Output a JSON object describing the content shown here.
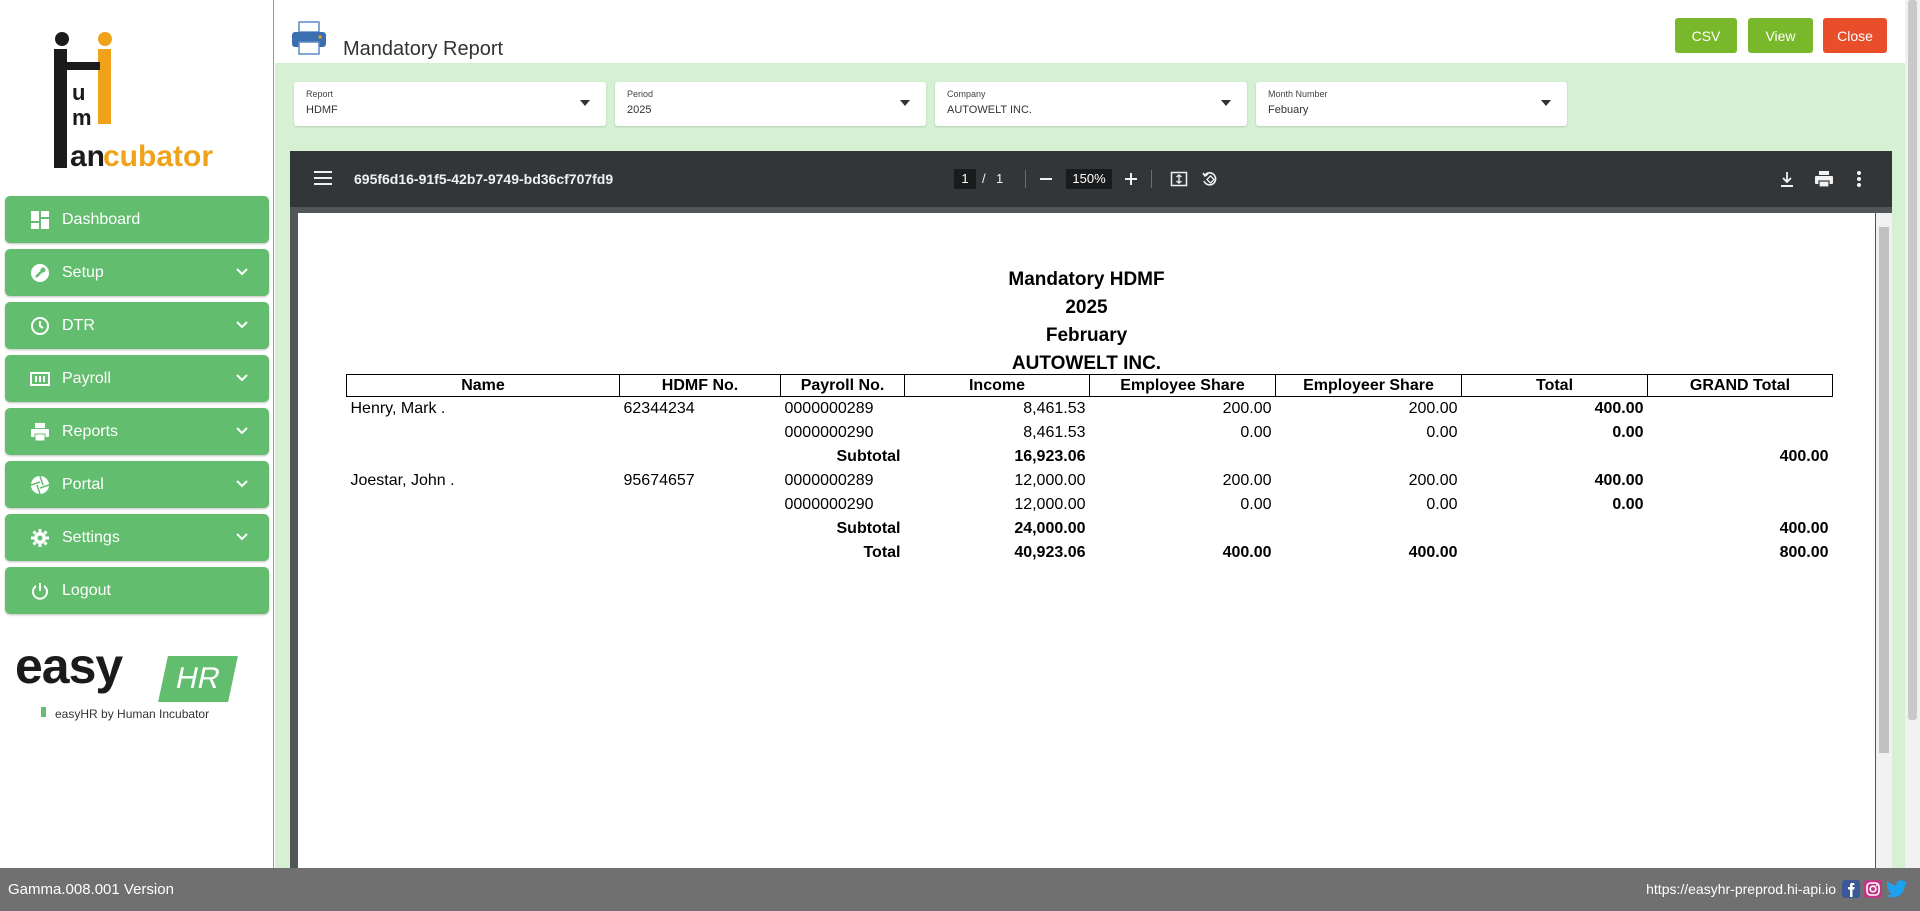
{
  "sidebar": {
    "brand_lines": [
      "Human",
      "Incubator"
    ],
    "items": [
      {
        "label": "Dashboard",
        "icon": "dashboard-icon"
      },
      {
        "label": "Setup",
        "icon": "wrench-icon"
      },
      {
        "label": "DTR",
        "icon": "clock-icon"
      },
      {
        "label": "Payroll",
        "icon": "money-icon"
      },
      {
        "label": "Reports",
        "icon": "printer-icon"
      },
      {
        "label": "Portal",
        "icon": "aperture-icon"
      },
      {
        "label": "Settings",
        "icon": "gear-icon"
      },
      {
        "label": "Logout",
        "icon": "power-icon"
      }
    ],
    "easyhr": {
      "word": "easy",
      "badge": "HR",
      "tagline": "easyHR by Human Incubator"
    }
  },
  "header": {
    "title": "Mandatory Report",
    "buttons": {
      "csv": "CSV",
      "view": "View",
      "close": "Close"
    }
  },
  "filters": {
    "report": {
      "label": "Report",
      "value": "HDMF"
    },
    "period": {
      "label": "Period",
      "value": "2025"
    },
    "company": {
      "label": "Company",
      "value": "AUTOWELT INC."
    },
    "month": {
      "label": "Month Number",
      "value": "Febuary"
    }
  },
  "viewer": {
    "doc_name": "695f6d16-91f5-42b7-9749-bd36cf707fd9",
    "page_current": "1",
    "page_sep": "/",
    "page_total": "1",
    "zoom": "150%"
  },
  "report": {
    "title_lines": [
      "Mandatory HDMF",
      "2025",
      "February",
      "AUTOWELT INC."
    ],
    "columns": [
      "Name",
      "HDMF No.",
      "Payroll No.",
      "Income",
      "Employee Share",
      "Employeer Share",
      "Total",
      "GRAND Total"
    ],
    "rows": [
      {
        "name": "Henry, Mark .",
        "hdmf": "62344234",
        "payroll": "0000000289",
        "income": "8,461.53",
        "ee": "200.00",
        "er": "200.00",
        "total": "400.00",
        "grand": ""
      },
      {
        "name": "",
        "hdmf": "",
        "payroll": "0000000290",
        "income": "8,461.53",
        "ee": "0.00",
        "er": "0.00",
        "total": "0.00",
        "grand": ""
      },
      {
        "name": "",
        "hdmf": "",
        "payroll": "Subtotal",
        "income": "16,923.06",
        "ee": "",
        "er": "",
        "total": "",
        "grand": "400.00",
        "bold": true
      },
      {
        "name": "Joestar, John .",
        "hdmf": "95674657",
        "payroll": "0000000289",
        "income": "12,000.00",
        "ee": "200.00",
        "er": "200.00",
        "total": "400.00",
        "grand": ""
      },
      {
        "name": "",
        "hdmf": "",
        "payroll": "0000000290",
        "income": "12,000.00",
        "ee": "0.00",
        "er": "0.00",
        "total": "0.00",
        "grand": ""
      },
      {
        "name": "",
        "hdmf": "",
        "payroll": "Subtotal",
        "income": "24,000.00",
        "ee": "",
        "er": "",
        "total": "",
        "grand": "400.00",
        "bold": true
      },
      {
        "name": "",
        "hdmf": "",
        "payroll": "Total",
        "income": "40,923.06",
        "ee": "400.00",
        "er": "400.00",
        "total": "",
        "grand": "800.00",
        "bold": true
      }
    ]
  },
  "footer": {
    "version": "Gamma.008.001 Version",
    "url": "https://easyhr-preprod.hi-api.io"
  },
  "colors": {
    "nav_green": "#62bd6e",
    "band_green": "#d6f0d3",
    "btn_green": "#78b82a",
    "btn_red": "#e94e2a",
    "viewer_dark": "#323639",
    "footer_gray": "#707070"
  }
}
